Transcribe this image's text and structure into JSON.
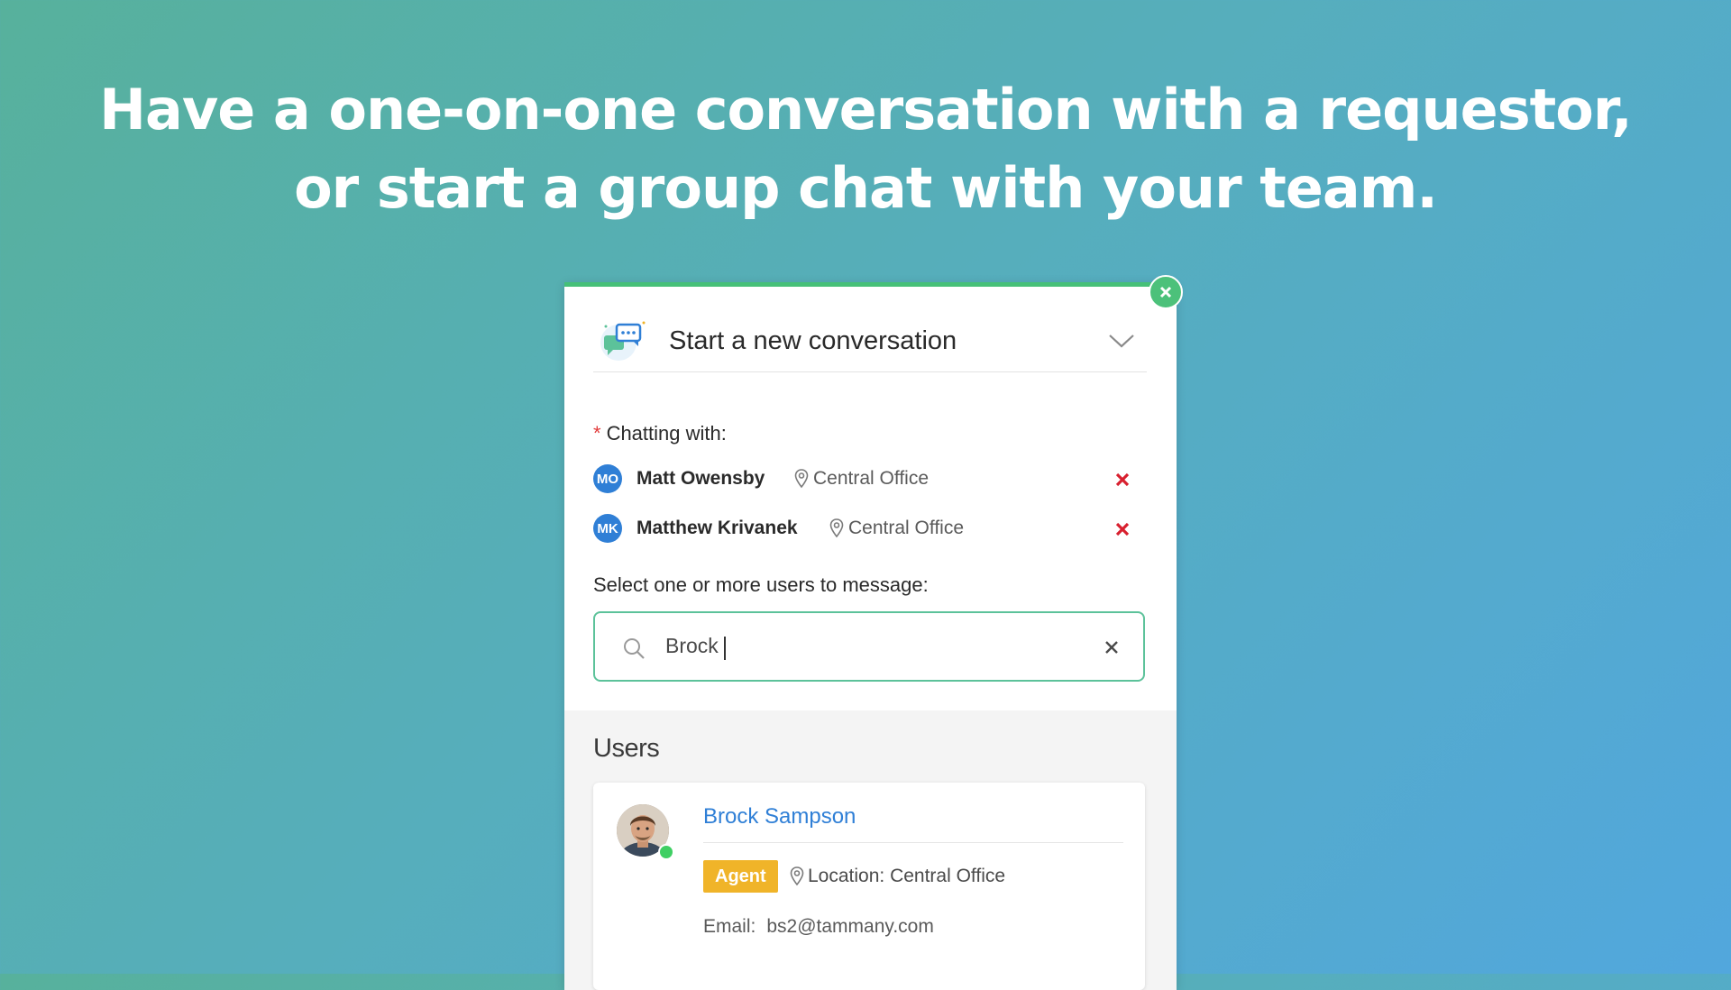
{
  "headline": {
    "line1": "Have a one-on-one conversation with a requestor,",
    "line2": "or start a group chat with your team."
  },
  "panel": {
    "title": "Start a new conversation",
    "required_mark": "*",
    "chatting_label": "Chatting with:",
    "chatting_with": [
      {
        "initials": "MO",
        "name": "Matt Owensby",
        "location": "Central Office"
      },
      {
        "initials": "MK",
        "name": "Matthew Krivanek",
        "location": "Central Office"
      }
    ],
    "select_label": "Select one or more users to message:",
    "search": {
      "value": "Brock",
      "placeholder": ""
    },
    "results_title": "Users",
    "result": {
      "name": "Brock Sampson",
      "role": "Agent",
      "location": "Location: Central Office",
      "email_label": "Email:",
      "email": "bs2@tammany.com",
      "status": "online"
    }
  },
  "icons": {
    "close": "close-icon",
    "chevron": "chevron-down-icon",
    "conversation": "chat-bubbles-icon",
    "location": "map-pin-icon",
    "remove": "remove-x-icon",
    "search": "search-icon",
    "clear": "clear-icon"
  },
  "colors": {
    "accent_green": "#46c078",
    "link_blue": "#2f7fd6",
    "remove_red": "#d8202f",
    "agent_badge": "#f0b429",
    "online": "#3fcf63"
  }
}
